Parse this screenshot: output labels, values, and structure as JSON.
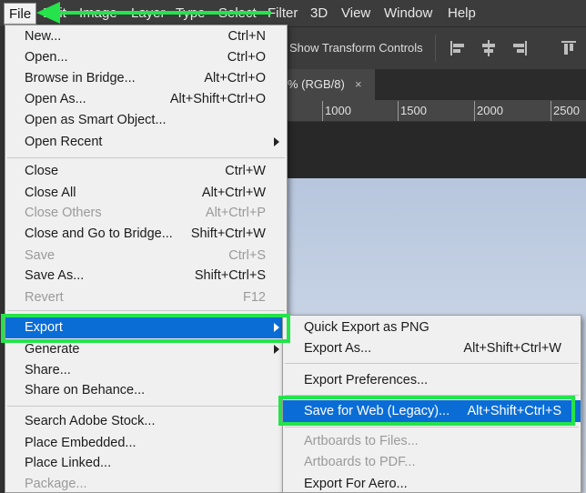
{
  "menubar": {
    "items": [
      "File",
      "Edit",
      "Image",
      "Layer",
      "Type",
      "Select",
      "Filter",
      "3D",
      "View",
      "Window",
      "Help"
    ]
  },
  "options_bar": {
    "show_transform_controls": "Show Transform Controls",
    "align_icons": [
      "align-left-icon",
      "align-center-icon",
      "align-right-icon",
      "align-top-icon"
    ]
  },
  "document": {
    "tab_title": "% (RGB/8)",
    "close_glyph": "×"
  },
  "ruler": {
    "ticks": [
      "1000",
      "1500",
      "2000",
      "2500"
    ]
  },
  "file_menu": {
    "items": [
      {
        "label": "New...",
        "shortcut": "Ctrl+N",
        "disabled": false
      },
      {
        "label": "Open...",
        "shortcut": "Ctrl+O",
        "disabled": false
      },
      {
        "label": "Browse in Bridge...",
        "shortcut": "Alt+Ctrl+O",
        "disabled": false
      },
      {
        "label": "Open As...",
        "shortcut": "Alt+Shift+Ctrl+O",
        "disabled": false
      },
      {
        "label": "Open as Smart Object...",
        "shortcut": "",
        "disabled": false
      },
      {
        "label": "Open Recent",
        "shortcut": "",
        "disabled": false,
        "submenu": true
      },
      {
        "label": "Close",
        "shortcut": "Ctrl+W",
        "disabled": false
      },
      {
        "label": "Close All",
        "shortcut": "Alt+Ctrl+W",
        "disabled": false
      },
      {
        "label": "Close Others",
        "shortcut": "Alt+Ctrl+P",
        "disabled": true
      },
      {
        "label": "Close and Go to Bridge...",
        "shortcut": "Shift+Ctrl+W",
        "disabled": false
      },
      {
        "label": "Save",
        "shortcut": "Ctrl+S",
        "disabled": true
      },
      {
        "label": "Save As...",
        "shortcut": "Shift+Ctrl+S",
        "disabled": false
      },
      {
        "label": "Revert",
        "shortcut": "F12",
        "disabled": true
      },
      {
        "label": "Export",
        "shortcut": "",
        "disabled": false,
        "submenu": true,
        "selected": true
      },
      {
        "label": "Generate",
        "shortcut": "",
        "disabled": false,
        "submenu": true
      },
      {
        "label": "Share...",
        "shortcut": "",
        "disabled": false
      },
      {
        "label": "Share on Behance...",
        "shortcut": "",
        "disabled": false
      },
      {
        "label": "Search Adobe Stock...",
        "shortcut": "",
        "disabled": false
      },
      {
        "label": "Place Embedded...",
        "shortcut": "",
        "disabled": false
      },
      {
        "label": "Place Linked...",
        "shortcut": "",
        "disabled": false
      },
      {
        "label": "Package...",
        "shortcut": "",
        "disabled": true
      }
    ]
  },
  "export_menu": {
    "items": [
      {
        "label": "Quick Export as PNG",
        "shortcut": "",
        "disabled": false
      },
      {
        "label": "Export As...",
        "shortcut": "Alt+Shift+Ctrl+W",
        "disabled": false
      },
      {
        "label": "Export Preferences...",
        "shortcut": "",
        "disabled": false
      },
      {
        "label": "Save for Web (Legacy)...",
        "shortcut": "Alt+Shift+Ctrl+S",
        "disabled": false,
        "selected": true
      },
      {
        "label": "Artboards to Files...",
        "shortcut": "",
        "disabled": true
      },
      {
        "label": "Artboards to PDF...",
        "shortcut": "",
        "disabled": true
      },
      {
        "label": "Export For Aero...",
        "shortcut": "",
        "disabled": false
      }
    ]
  },
  "colors": {
    "menu_bg": "#f0f0f0",
    "selection_blue": "#0a6dd6",
    "annotation_green": "#25e34a",
    "app_dark": "#3c3c3c"
  }
}
